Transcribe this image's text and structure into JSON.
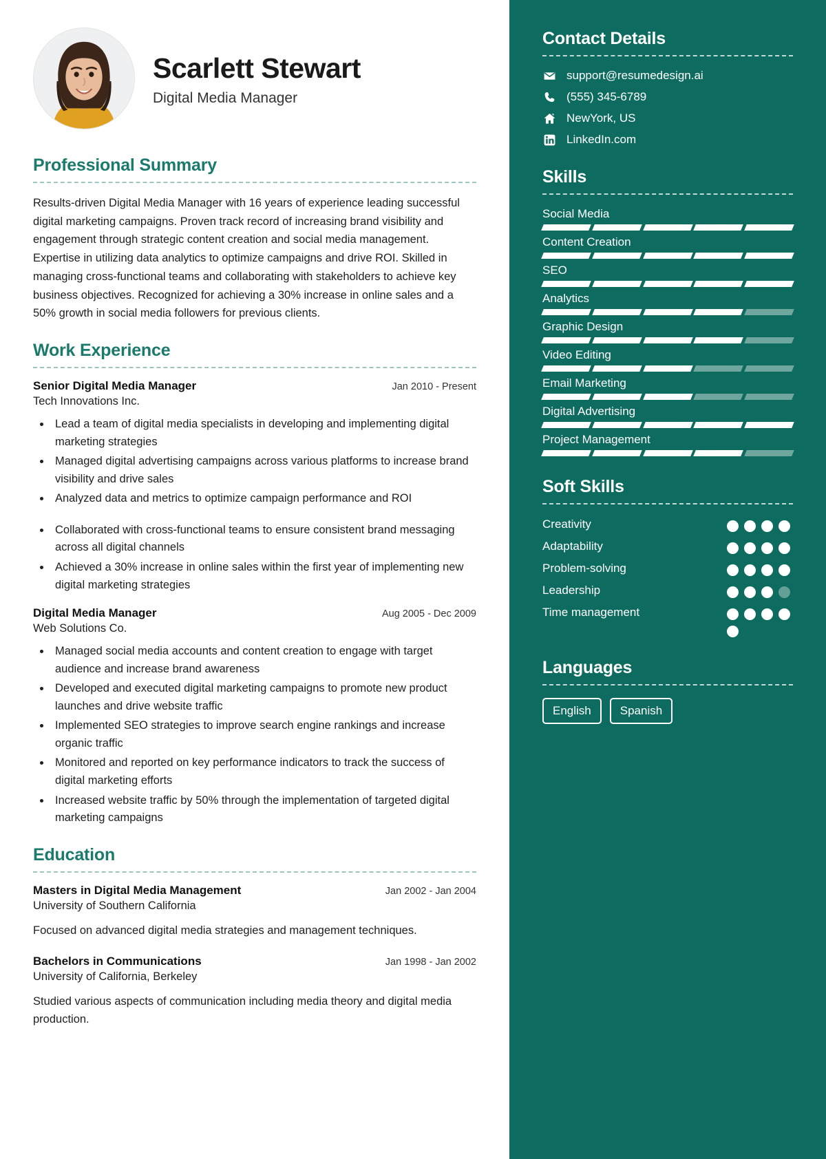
{
  "theme": {
    "accent": "#1b7a6c",
    "sidebar_bg": "#0d6b5f",
    "sidebar_text": "#ffffff",
    "dim": "#6fa69e"
  },
  "header": {
    "name": "Scarlett Stewart",
    "role": "Digital Media Manager",
    "avatar_alt": "profile-photo"
  },
  "summary": {
    "heading": "Professional Summary",
    "text": "Results-driven Digital Media Manager with 16 years of experience leading successful digital marketing campaigns. Proven track record of increasing brand visibility and engagement through strategic content creation and social media management. Expertise in utilizing data analytics to optimize campaigns and drive ROI. Skilled in managing cross-functional teams and collaborating with stakeholders to achieve key business objectives. Recognized for achieving a 30% increase in online sales and a 50% growth in social media followers for previous clients."
  },
  "experience": {
    "heading": "Work Experience",
    "jobs": [
      {
        "title": "Senior Digital Media Manager",
        "date": "Jan 2010 - Present",
        "org": "Tech Innovations Inc.",
        "bullets": [
          "Lead a team of digital media specialists in developing and implementing digital marketing strategies",
          "Managed digital advertising campaigns across various platforms to increase brand visibility and drive sales",
          "Analyzed data and metrics to optimize campaign performance and ROI",
          "Collaborated with cross-functional teams to ensure consistent brand messaging across all digital channels",
          "Achieved a 30% increase in online sales within the first year of implementing new digital marketing strategies"
        ]
      },
      {
        "title": "Digital Media Manager",
        "date": "Aug 2005 - Dec 2009",
        "org": "Web Solutions Co.",
        "bullets": [
          "Managed social media accounts and content creation to engage with target audience and increase brand awareness",
          "Developed and executed digital marketing campaigns to promote new product launches and drive website traffic",
          "Implemented SEO strategies to improve search engine rankings and increase organic traffic",
          "Monitored and reported on key performance indicators to track the success of digital marketing efforts",
          "Increased website traffic by 50% through the implementation of targeted digital marketing campaigns"
        ]
      }
    ]
  },
  "education": {
    "heading": "Education",
    "items": [
      {
        "title": "Masters in Digital Media Management",
        "date": "Jan 2002 - Jan 2004",
        "org": "University of Southern California",
        "desc": "Focused on advanced digital media strategies and management techniques."
      },
      {
        "title": "Bachelors in Communications",
        "date": "Jan 1998 - Jan 2002",
        "org": "University of California, Berkeley",
        "desc": "Studied various aspects of communication including media theory and digital media production."
      }
    ]
  },
  "contact": {
    "heading": "Contact Details",
    "items": [
      {
        "icon": "email-icon",
        "value": "support@resumedesign.ai"
      },
      {
        "icon": "phone-icon",
        "value": "(555) 345-6789"
      },
      {
        "icon": "home-icon",
        "value": "NewYork, US"
      },
      {
        "icon": "linkedin-icon",
        "value": "LinkedIn.com"
      }
    ]
  },
  "skills": {
    "heading": "Skills",
    "segments_total": 5,
    "items": [
      {
        "label": "Social Media",
        "filled": 5
      },
      {
        "label": "Content Creation",
        "filled": 5
      },
      {
        "label": "SEO",
        "filled": 5
      },
      {
        "label": "Analytics",
        "filled": 4
      },
      {
        "label": "Graphic Design",
        "filled": 4
      },
      {
        "label": "Video Editing",
        "filled": 3
      },
      {
        "label": "Email Marketing",
        "filled": 3
      },
      {
        "label": "Digital Advertising",
        "filled": 5
      },
      {
        "label": "Project Management",
        "filled": 4
      }
    ]
  },
  "soft_skills": {
    "heading": "Soft Skills",
    "dots_total": 4,
    "items": [
      {
        "label": "Creativity",
        "filled": 4
      },
      {
        "label": "Adaptability",
        "filled": 4
      },
      {
        "label": "Problem-solving",
        "filled": 4
      },
      {
        "label": "Leadership",
        "filled": 3
      },
      {
        "label": "Time management",
        "filled": 5
      }
    ]
  },
  "languages": {
    "heading": "Languages",
    "items": [
      "English",
      "Spanish"
    ]
  }
}
